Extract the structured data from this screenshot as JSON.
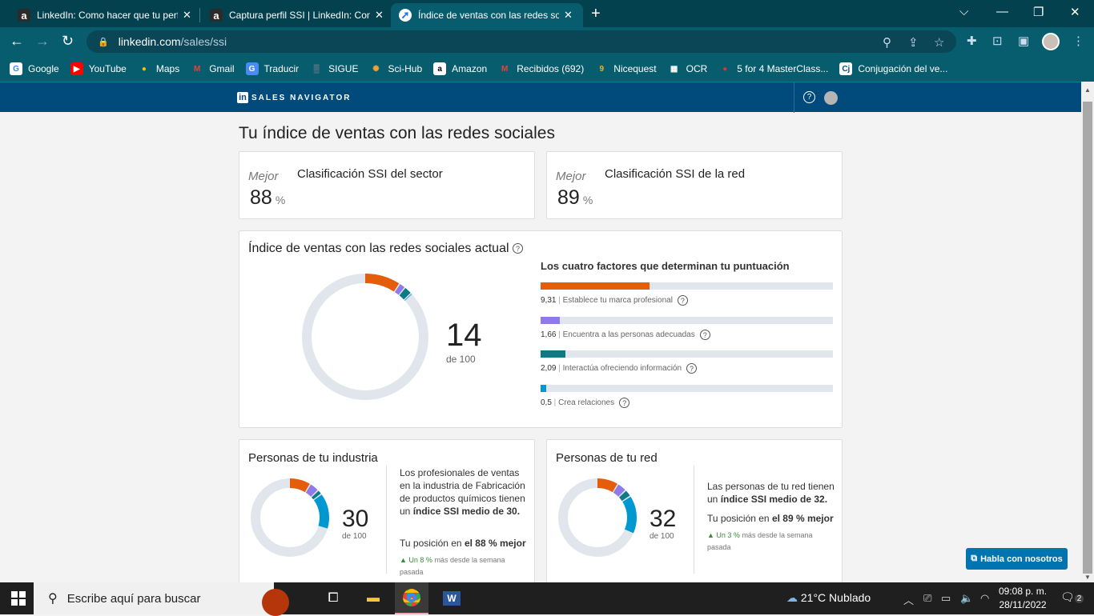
{
  "browser": {
    "tabs": [
      {
        "title": "LinkedIn: Como hacer que tu perfil",
        "icon": "a",
        "active": false
      },
      {
        "title": "Captura perfil SSI | LinkedIn: Como",
        "icon": "a",
        "active": false
      },
      {
        "title": "Índice de ventas con las redes sociales",
        "icon": "compass",
        "active": true
      }
    ],
    "new_tab": "+",
    "window_controls": {
      "dropdown": "⌵",
      "minimize": "—",
      "restore": "❐",
      "close": "✕"
    },
    "url_domain": "linkedin.com",
    "url_path": "/sales/ssi",
    "bookmarks": [
      {
        "label": "Google",
        "icon": "G",
        "color": "#ffffff",
        "fg": "#4285f4"
      },
      {
        "label": "YouTube",
        "icon": "▶",
        "color": "#ff0000",
        "fg": "#ffffff"
      },
      {
        "label": "Maps",
        "icon": "●",
        "color": "transparent",
        "fg": "#fbbc04"
      },
      {
        "label": "Gmail",
        "icon": "M",
        "color": "transparent",
        "fg": "#ea4335"
      },
      {
        "label": "Traducir",
        "icon": "G",
        "color": "#4a8af4",
        "fg": "#ffffff"
      },
      {
        "label": "SIGUE",
        "icon": "▒",
        "color": "transparent",
        "fg": "#c9a"
      },
      {
        "label": "Sci-Hub",
        "icon": "✺",
        "color": "transparent",
        "fg": "#f0a030"
      },
      {
        "label": "Amazon",
        "icon": "a",
        "color": "#ffffff",
        "fg": "#000000"
      },
      {
        "label": "Recibidos (692)",
        "icon": "M",
        "color": "transparent",
        "fg": "#ea4335"
      },
      {
        "label": "Nicequest",
        "icon": "9",
        "color": "transparent",
        "fg": "#f6b21b"
      },
      {
        "label": "OCR",
        "icon": "▦",
        "color": "transparent",
        "fg": "#ffffff"
      },
      {
        "label": "5 for 4 MasterClass...",
        "icon": "●",
        "color": "transparent",
        "fg": "#d33"
      },
      {
        "label": "Conjugación del ve...",
        "icon": "Cj",
        "color": "#ffffff",
        "fg": "#0b4f8a"
      }
    ]
  },
  "sales_nav": {
    "logo_in": "in",
    "logo_text": "SALES NAVIGATOR",
    "help": "?"
  },
  "page": {
    "title": "Tu índice de ventas con las redes sociales",
    "rank_cards": [
      {
        "prefix": "Mejor",
        "label": "Clasificación SSI del sector",
        "value": "88",
        "unit": "%"
      },
      {
        "prefix": "Mejor",
        "label": "Clasificación SSI de la red",
        "value": "89",
        "unit": "%"
      }
    ],
    "ssi": {
      "title": "Índice de ventas con las redes sociales actual",
      "score": "14",
      "of": "de 100",
      "factors_title": "Los cuatro factores que determinan tu puntuación",
      "factors": [
        {
          "value": 9.31,
          "value_label": "9,31",
          "label": "Establece tu marca profesional",
          "color": "#e35d0a"
        },
        {
          "value": 1.66,
          "value_label": "1,66",
          "label": "Encuentra a las personas adecuadas",
          "color": "#8e7ae8"
        },
        {
          "value": 2.09,
          "value_label": "2,09",
          "label": "Interactúa ofreciendo información",
          "color": "#0f7a86"
        },
        {
          "value": 0.5,
          "value_label": "0,5",
          "label": "Crea relaciones",
          "color": "#0098d1"
        }
      ],
      "factor_max": 25,
      "separator": "|"
    },
    "industry": {
      "title": "Personas de tu industria",
      "score": "30",
      "of": "de 100",
      "segments": [
        9,
        4,
        2,
        15
      ],
      "text_prefix": "Los profesionales de ventas en la industria de Fabricación de productos químicos tienen un ",
      "text_bold": "índice SSI medio de 30.",
      "position_prefix": "Tu posición en ",
      "position_bold": "el 88 % mejor",
      "change_bold": "Un 8 %",
      "change_rest": " más desde la semana pasada"
    },
    "network": {
      "title": "Personas de tu red",
      "score": "32",
      "of": "de 100",
      "segments": [
        9,
        4,
        3,
        16
      ],
      "text_prefix": "Las personas de tu red tienen un ",
      "text_bold": "índice SSI medio de 32.",
      "position_prefix": "Tu posición en ",
      "position_bold": "el 89 % mejor",
      "change_bold": "Un 3 %",
      "change_rest": " más desde la semana pasada"
    },
    "chat_button": "Habla con nosotros"
  },
  "colors": {
    "brand": "#004b7c",
    "orange": "#e35d0a",
    "purple": "#8e7ae8",
    "teal": "#0f7a86",
    "blue": "#0098d1",
    "track": "#e1e6ec"
  },
  "taskbar": {
    "search_placeholder": "Escribe aquí para buscar",
    "weather": "21°C  Nublado",
    "time": "09:08 p. m.",
    "date": "28/11/2022",
    "notifications": "2"
  }
}
